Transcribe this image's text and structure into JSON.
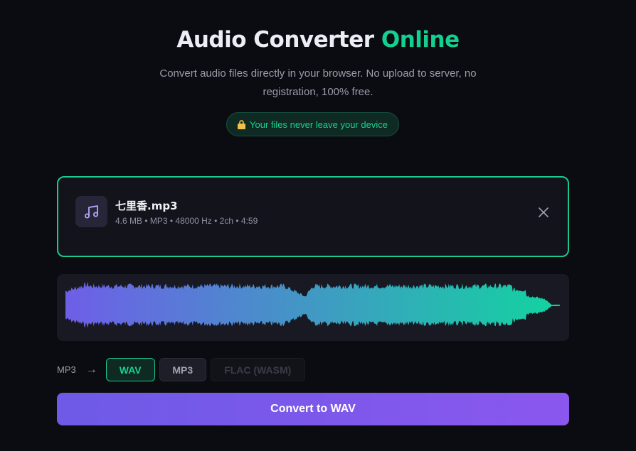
{
  "header": {
    "title_main": "Audio Converter",
    "title_accent": "Online",
    "subtitle": "Convert audio files directly in your browser. No upload to server, no registration, 100% free.",
    "privacy_badge": "Your files never leave your device"
  },
  "file": {
    "name": "七里香.mp3",
    "meta": "4.6 MB • MP3 • 48000 Hz • 2ch • 4:59",
    "icon": "music-note-icon"
  },
  "conversion": {
    "source_format": "MP3",
    "arrow": "→",
    "formats": [
      {
        "label": "WAV",
        "state": "selected"
      },
      {
        "label": "MP3",
        "state": "available"
      },
      {
        "label": "FLAC (WASM)",
        "state": "disabled"
      }
    ],
    "convert_label": "Convert to WAV"
  },
  "colors": {
    "accent": "#13d08f",
    "waveform_start": "#6f5ee8",
    "waveform_end": "#12d4a0",
    "button_start": "#6d5ae6",
    "button_end": "#8b57ee"
  }
}
